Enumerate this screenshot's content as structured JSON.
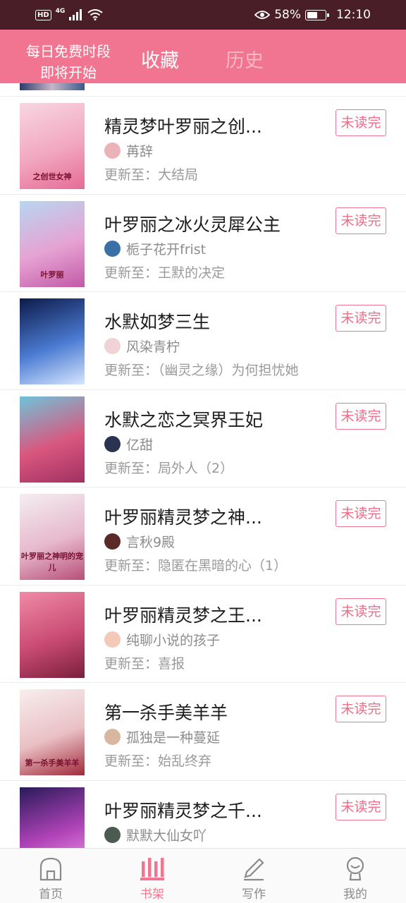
{
  "status_bar": {
    "hd": "HD",
    "network": "4G",
    "battery_percent": "58%",
    "battery_level": 0.58,
    "time": "12:10"
  },
  "header": {
    "promo_line1": "每日免费时段",
    "promo_line2": "即将开始",
    "tab_favorites": "收藏",
    "tab_history": "历史"
  },
  "books": [
    {
      "title": "精灵梦叶罗丽之创...",
      "author": "苒辞",
      "update": "更新至：大结局",
      "status": "未读完",
      "cover_text": "之创世女神",
      "cover_colors": [
        "#f7d6e2",
        "#f2a7c0",
        "#e56c97"
      ],
      "avatar_color": "#e9b3b8"
    },
    {
      "title": "叶罗丽之冰火灵犀公主",
      "author": "栀子花开frist",
      "update": "更新至：王默的决定",
      "status": "未读完",
      "cover_text": "叶罗丽",
      "cover_colors": [
        "#b8d6f0",
        "#e6a2d3",
        "#c25aa7"
      ],
      "avatar_color": "#3b6fa8"
    },
    {
      "title": "水默如梦三生",
      "author": "风染青柠",
      "update": "更新至：（幽灵之缘）为何担忧她",
      "status": "未读完",
      "cover_text": "",
      "cover_colors": [
        "#0d1a4a",
        "#4a7ad1",
        "#d6e6ff"
      ],
      "avatar_color": "#f0d3d6"
    },
    {
      "title": "水默之恋之冥界王妃",
      "author": "亿甜",
      "update": "更新至：局外人（2）",
      "status": "未读完",
      "cover_text": "",
      "cover_colors": [
        "#6fc3d9",
        "#d9577f",
        "#a03060"
      ],
      "avatar_color": "#2a3350"
    },
    {
      "title": "叶罗丽精灵梦之神...",
      "author": "言秋9殿",
      "update": "更新至：隐匿在黑暗的心（1）",
      "status": "未读完",
      "cover_text": "叶罗丽之神明的宠儿",
      "cover_colors": [
        "#f4eef2",
        "#e7b9cc",
        "#b84f78"
      ],
      "avatar_color": "#5a2a2a"
    },
    {
      "title": "叶罗丽精灵梦之王...",
      "author": "纯聊小说的孩子",
      "update": "更新至：喜报",
      "status": "未读完",
      "cover_text": "",
      "cover_colors": [
        "#f08aa7",
        "#c94b74",
        "#7a1f3d"
      ],
      "avatar_color": "#f3c9b8"
    },
    {
      "title": "第一杀手美羊羊",
      "author": "孤独是一种蔓延",
      "update": "更新至：始乱终弃",
      "status": "未读完",
      "cover_text": "第一杀手美羊羊",
      "cover_colors": [
        "#f7eeee",
        "#eac0c4",
        "#a02a3a"
      ],
      "avatar_color": "#d8b7a0"
    },
    {
      "title": "叶罗丽精灵梦之千...",
      "author": "默默大仙女吖",
      "update": "",
      "status": "未读完",
      "cover_text": "",
      "cover_colors": [
        "#2a1a5a",
        "#b043b8",
        "#f3a0e8"
      ],
      "avatar_color": "#4d5a4f"
    }
  ],
  "bottom_nav": [
    {
      "label": "首页",
      "icon": "home-icon",
      "active": false
    },
    {
      "label": "书架",
      "icon": "bookshelf-icon",
      "active": true
    },
    {
      "label": "写作",
      "icon": "pen-icon",
      "active": false
    },
    {
      "label": "我的",
      "icon": "profile-icon",
      "active": false
    }
  ],
  "colors": {
    "status_bar": "#4a1e26",
    "header": "#f17590",
    "accent": "#f17590"
  }
}
